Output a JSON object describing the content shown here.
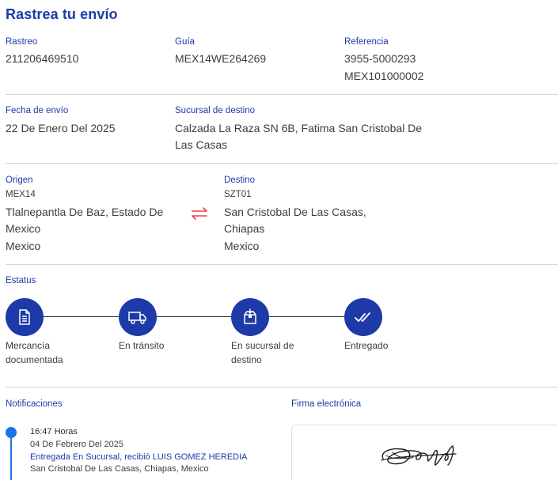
{
  "title": "Rastrea tu envío",
  "rastreo": {
    "label": "Rastreo",
    "value": "211206469510"
  },
  "guia": {
    "label": "Guía",
    "value": "MEX14WE264269"
  },
  "referencia": {
    "label": "Referencia",
    "value_1": "3955-5000293",
    "value_2": "MEX101000002"
  },
  "fecha_envio": {
    "label": "Fecha de envío",
    "value": "22 De Enero Del 2025"
  },
  "sucursal_destino": {
    "label": "Sucursal de destino",
    "line_1": "Calzada La Raza SN 6B, Fatima San Cristobal De",
    "line_2": "Las Casas"
  },
  "origen": {
    "label": "Origen",
    "code": "MEX14",
    "line_1": "Tlalnepantla De Baz, Estado De",
    "line_2": "Mexico",
    "country": "Mexico"
  },
  "destino": {
    "label": "Destino",
    "code": "SZT01",
    "line_1": "San Cristobal De Las Casas,",
    "line_2": "Chiapas",
    "country": "Mexico"
  },
  "estatus": {
    "label": "Estatus",
    "steps": [
      {
        "line_1": "Mercancía",
        "line_2": "documentada",
        "icon": "document-icon"
      },
      {
        "line_1": "En tránsito",
        "line_2": "",
        "icon": "truck-icon"
      },
      {
        "line_1": "En sucursal de",
        "line_2": "destino",
        "icon": "package-icon"
      },
      {
        "line_1": "Entregado",
        "line_2": "",
        "icon": "double-check-icon"
      }
    ]
  },
  "notificaciones": {
    "label": "Notificaciones",
    "items": [
      {
        "time": "16:47 Horas",
        "date": "04 De Febrero Del 2025",
        "event": "Entregada En Sucursal, recibió LUIS GOMEZ HEREDIA",
        "place": "San Cristobal De Las Casas, Chiapas, Mexico"
      }
    ]
  },
  "firma": {
    "label": "Firma electrónica"
  },
  "colors": {
    "brand": "#1d3aa8",
    "accent_red": "#e8413b",
    "timeline_blue": "#1a73e8"
  }
}
